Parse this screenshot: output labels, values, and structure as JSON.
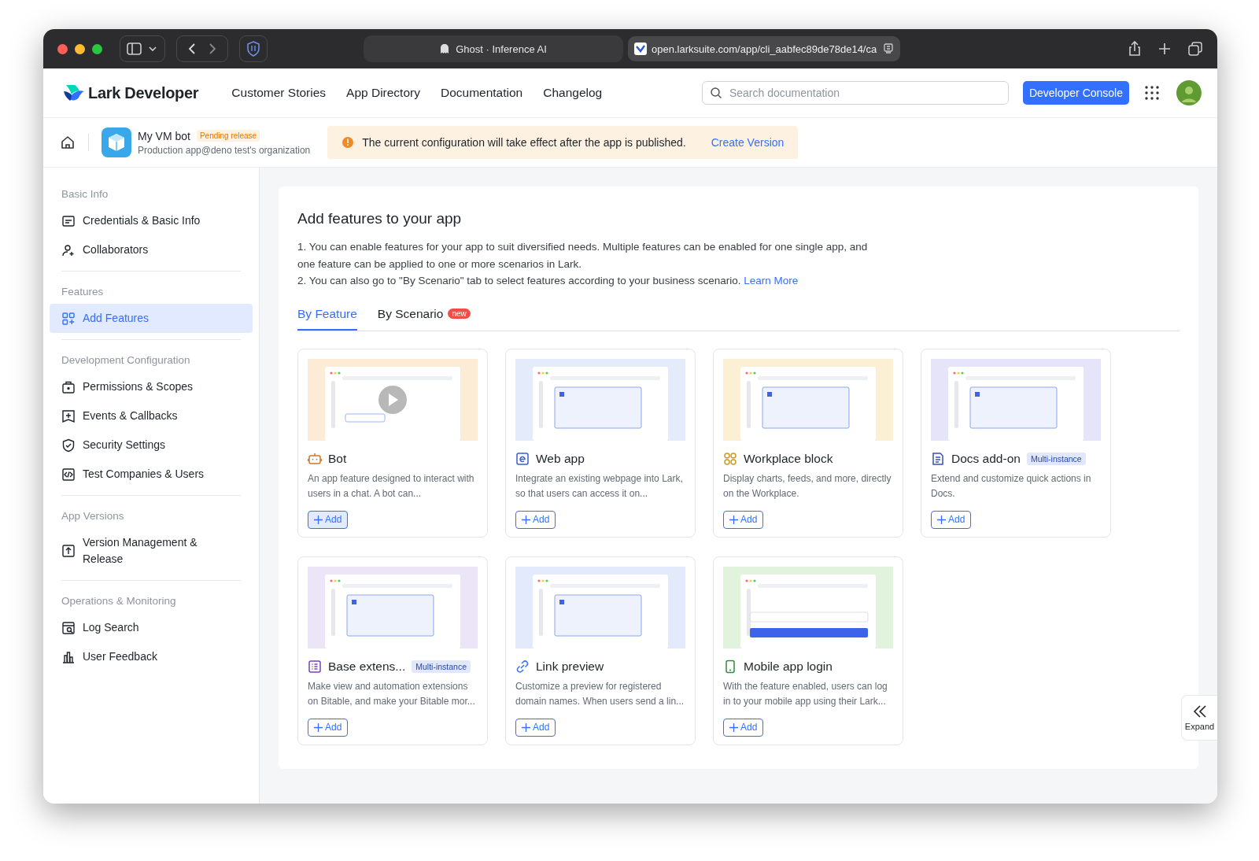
{
  "browser": {
    "tab_title": "Ghost · Inference AI",
    "url": "open.larksuite.com/app/cli_aabfec89de78de14/ca"
  },
  "header": {
    "logo": "Lark Developer",
    "nav": [
      "Customer Stories",
      "App Directory",
      "Documentation",
      "Changelog"
    ],
    "search": {
      "placeholder": "Search documentation"
    },
    "console_button": "Developer Console"
  },
  "app": {
    "name": "My VM bot",
    "status": "Pending release",
    "organization": "Production app@deno test's organization"
  },
  "notice": {
    "text": "The current configuration will take effect after the app is published.",
    "link": "Create Version"
  },
  "sidebar": [
    {
      "heading": "Basic Info",
      "items": [
        {
          "kind": "credentials",
          "label": "Credentials & Basic Info",
          "selected": false
        },
        {
          "kind": "collaborators",
          "label": "Collaborators",
          "selected": false
        }
      ]
    },
    {
      "heading": "Features",
      "items": [
        {
          "kind": "features",
          "label": "Add Features",
          "selected": true
        }
      ]
    },
    {
      "heading": "Development Configuration",
      "items": [
        {
          "kind": "permissions",
          "label": "Permissions & Scopes",
          "selected": false
        },
        {
          "kind": "events",
          "label": "Events & Callbacks",
          "selected": false
        },
        {
          "kind": "security",
          "label": "Security Settings",
          "selected": false
        },
        {
          "kind": "test",
          "label": "Test Companies & Users",
          "selected": false
        }
      ]
    },
    {
      "heading": "App Versions",
      "items": [
        {
          "kind": "version",
          "label": "Version Management & Release",
          "selected": false
        }
      ]
    },
    {
      "heading": "Operations & Monitoring",
      "items": [
        {
          "kind": "log",
          "label": "Log Search",
          "selected": false
        },
        {
          "kind": "feedback",
          "label": "User Feedback",
          "selected": false
        }
      ]
    }
  ],
  "main": {
    "title": "Add features to your app",
    "intro": [
      "1. You can enable features for your app to suit diversified needs. Multiple features can be enabled for one single app, and one feature can be applied to one or more scenarios in Lark."
    ],
    "intro_2": {
      "text": "2. You can also go to \"By Scenario\" tab to select features according to your business scenario.",
      "link": "Learn More"
    },
    "tabs": [
      {
        "label": "By Feature",
        "selected": true
      },
      {
        "label": "By Scenario",
        "selected": false,
        "badge": "new"
      }
    ],
    "cards": [
      {
        "kind": "bot",
        "title": "Bot",
        "description": "An app feature designed to interact with users in a chat. A bot can...",
        "button": "Add",
        "hovered": true
      },
      {
        "kind": "webapp",
        "title": "Web app",
        "description": "Integrate an existing webpage into Lark, so that users can access it on...",
        "button": "Add",
        "hovered": false
      },
      {
        "kind": "workplace",
        "title": "Workplace block",
        "description": "Display charts, feeds, and more, directly on the Workplace.",
        "button": "Add",
        "hovered": false
      },
      {
        "kind": "docs",
        "title": "Docs add-on",
        "badge": "Multi-instance",
        "description": "Extend and customize quick actions in Docs.",
        "button": "Add",
        "hovered": false
      },
      {
        "kind": "base",
        "title": "Base extens...",
        "badge": "Multi-instance",
        "description": "Make view and automation extensions on Bitable, and make your Bitable mor...",
        "button": "Add",
        "hovered": false
      },
      {
        "kind": "link",
        "title": "Link preview",
        "description": "Customize a preview for registered domain names. When users send a lin...",
        "button": "Add",
        "hovered": false
      },
      {
        "kind": "mobile",
        "title": "Mobile app login",
        "description": "With the feature enabled, users can log in to your mobile app using their Lark...",
        "button": "Add",
        "hovered": false
      }
    ]
  },
  "expand_button": "Expand"
}
